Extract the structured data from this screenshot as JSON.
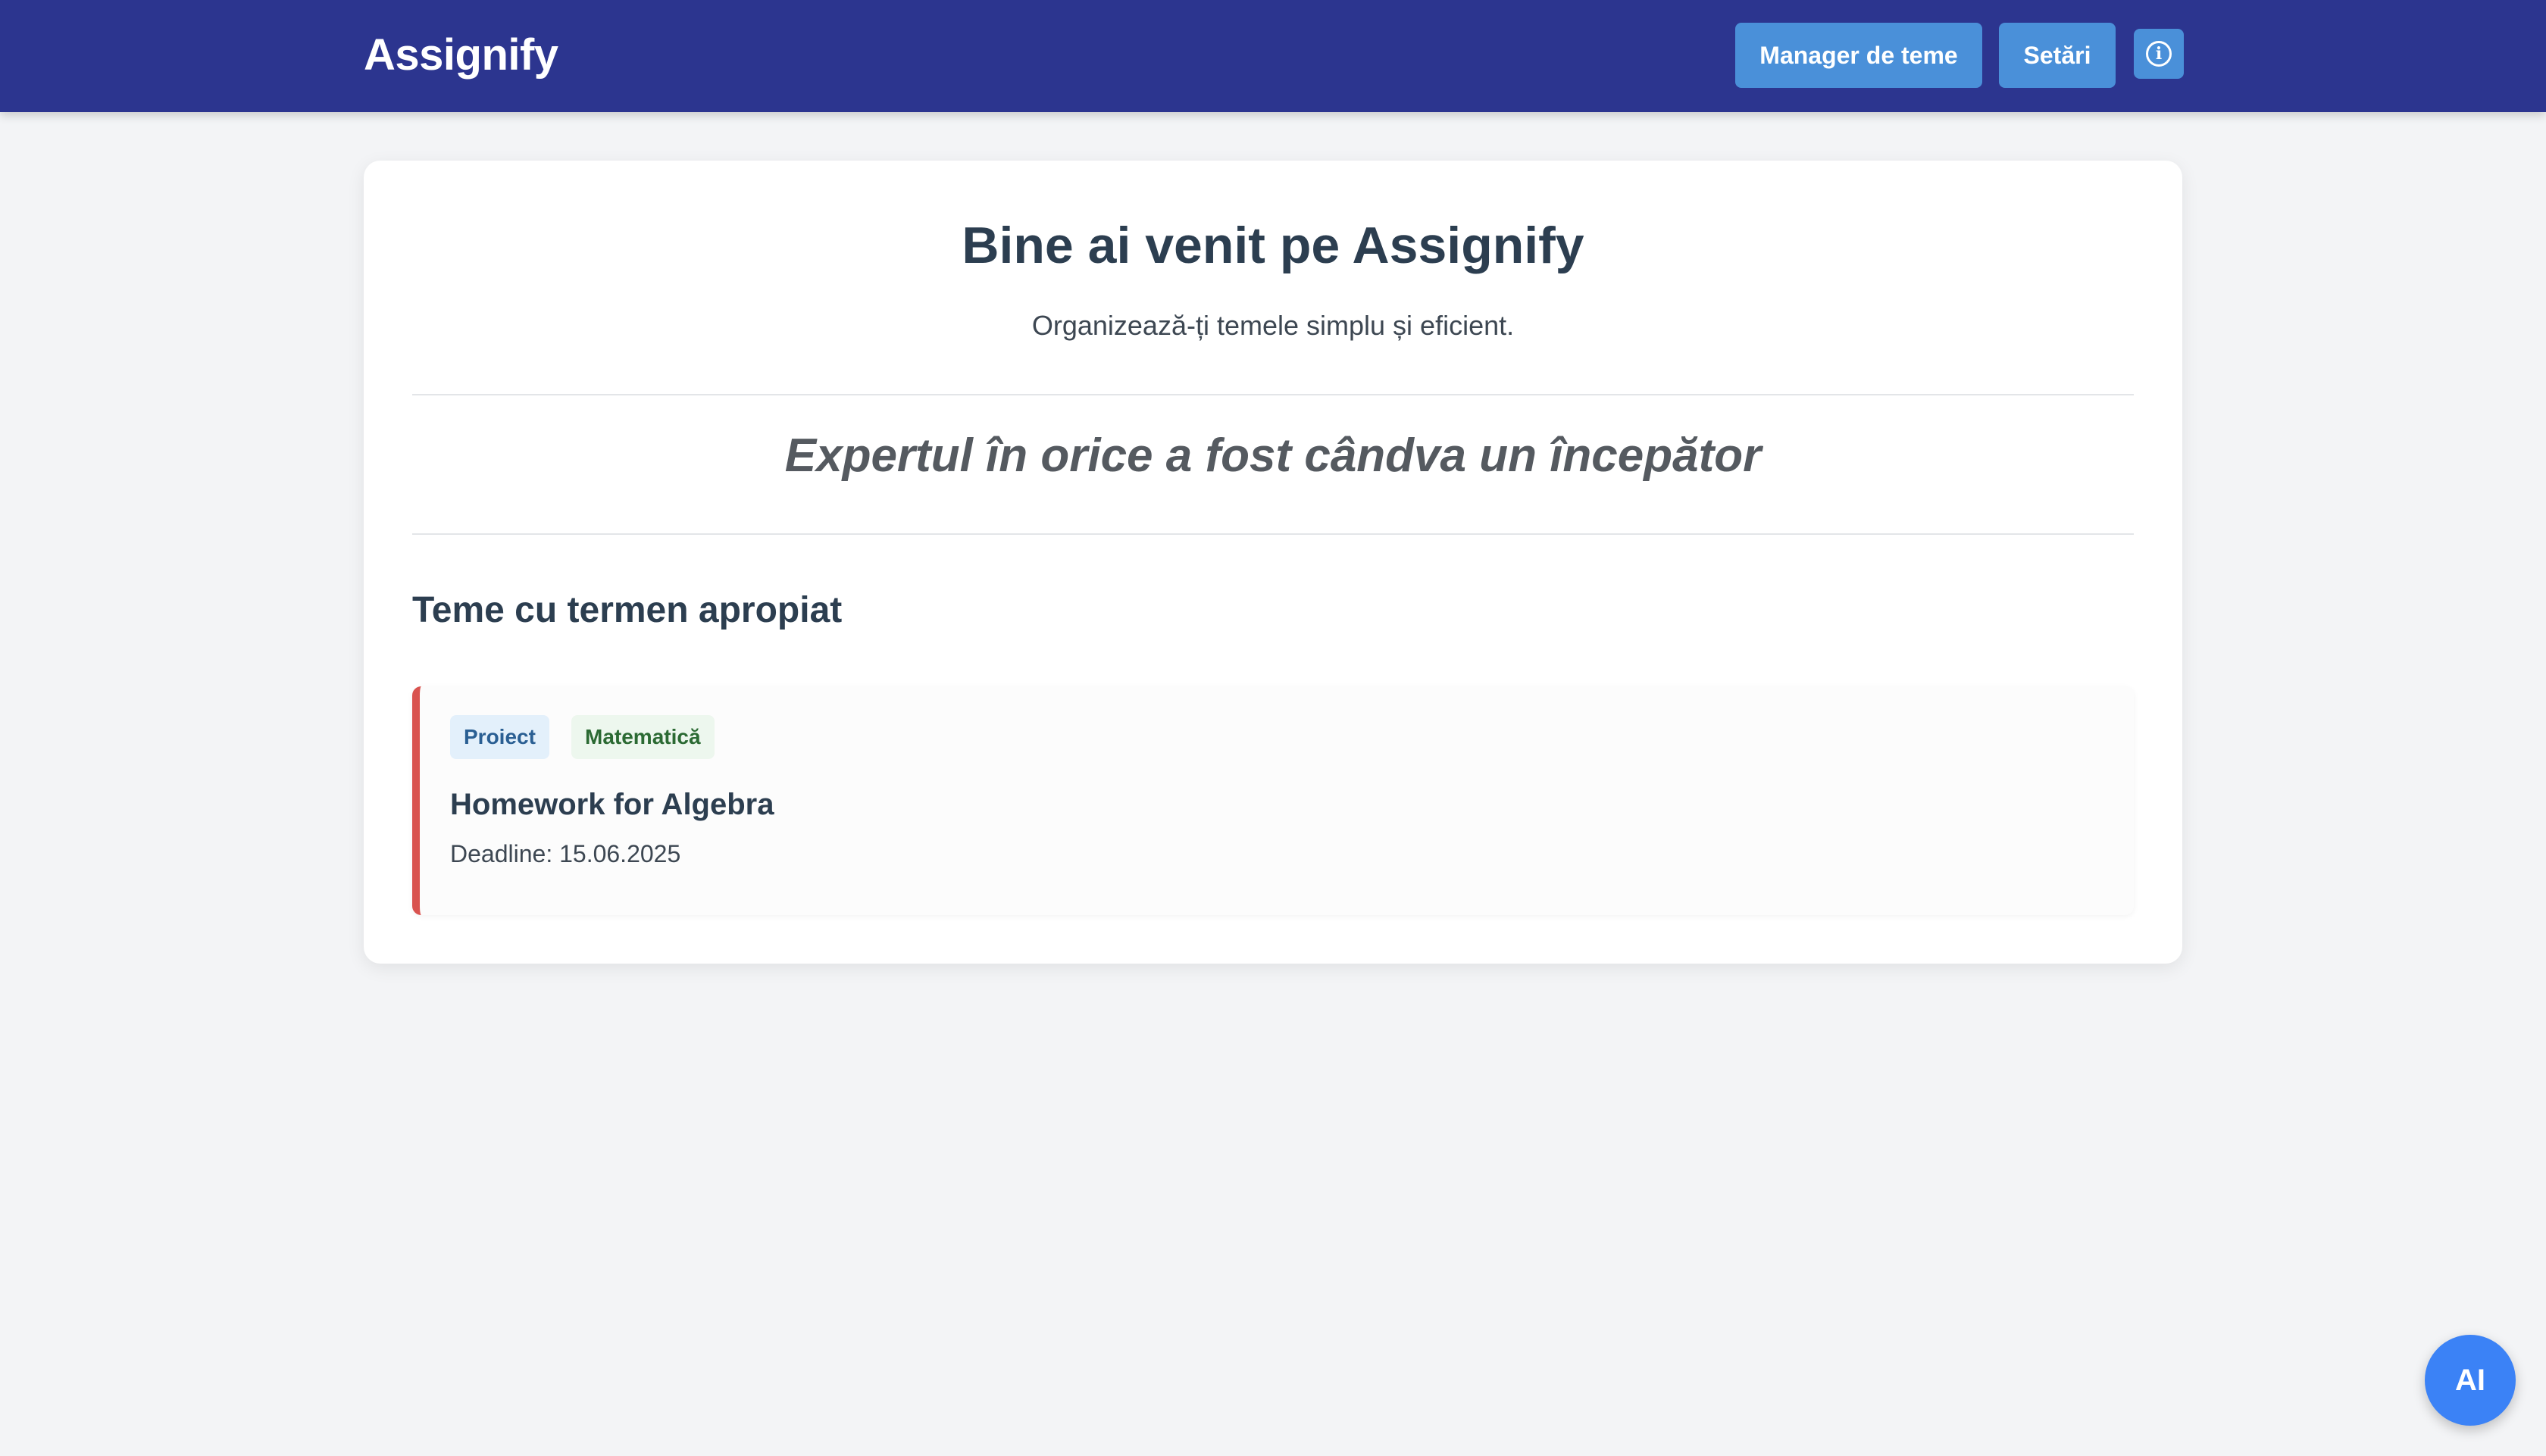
{
  "navbar": {
    "brand": "Assignify",
    "manager_label": "Manager de teme",
    "settings_label": "Setări",
    "info_icon": "info-icon",
    "info_glyph": "i"
  },
  "main": {
    "title": "Bine ai venit pe Assignify",
    "subtitle": "Organizează-ți temele simplu și eficient.",
    "quote": "Expertul în orice a fost cândva un începător",
    "section_title": "Teme cu termen apropiat",
    "tasks": [
      {
        "type_tag": "Proiect",
        "subject_tag": "Matematică",
        "title": "Homework for Algebra",
        "deadline": "Deadline: 15.06.2025",
        "accent_color": "#d9534f"
      }
    ]
  },
  "fab": {
    "label": "AI"
  },
  "colors": {
    "navbar": "#2c358f",
    "button": "#4a90d9",
    "fab": "#3b82f6",
    "background": "#f3f4f6"
  }
}
